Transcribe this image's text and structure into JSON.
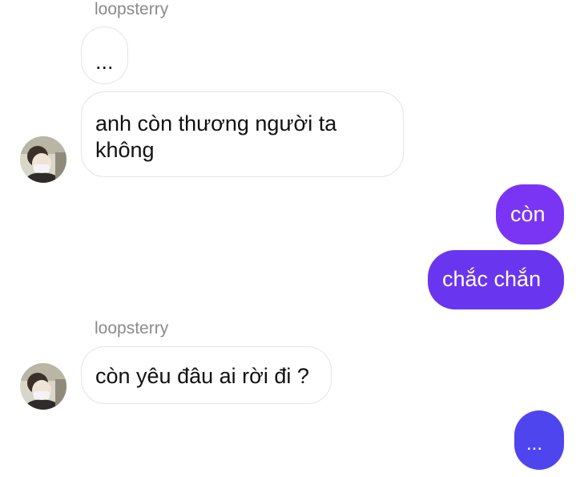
{
  "thread": {
    "group1": {
      "sender": "loopsterry",
      "msg1": "...",
      "msg2": "anh còn thương người ta không"
    },
    "outgoing": {
      "msg1": "còn",
      "msg2": "chắc chắn"
    },
    "group2": {
      "sender": "loopsterry",
      "msg1": "còn yêu đâu ai rời đi ?"
    },
    "outgoing2": {
      "msg1": "..."
    }
  },
  "colors": {
    "outgoing_top": "#7a35f4",
    "outgoing_mid": "#6a35ef",
    "outgoing_bottom": "#4f45ef",
    "incoming_border": "#e4e4e4",
    "sender_text": "#8a8a8a"
  },
  "icons": {
    "avatar": "profile-photo"
  }
}
